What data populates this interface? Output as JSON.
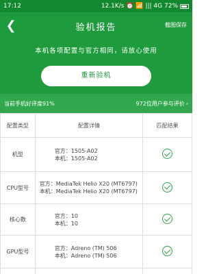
{
  "status_bar": {
    "time": "17:12",
    "indicators": "12.1K/s ⏰ 📶 ||| 4G 72%",
    "battery_level": 0.72
  },
  "header": {
    "title": "验机报告",
    "action": "截图保存"
  },
  "summary": {
    "tagline": "本机各项配置与官方相同，请放心使用",
    "retest_label": "重新验机"
  },
  "score_bar": {
    "left": "当前手机好评度91%",
    "right": "972位用户参与评价"
  },
  "table": {
    "headers": [
      "配置类型",
      "配置详情",
      "匹配结果"
    ],
    "rows": [
      {
        "type": "机型",
        "official": "官方：1505-A02",
        "device": "本机：1505-A02"
      },
      {
        "type": "CPU型号",
        "official": "官方：MediaTek Helio X20 (MT6797)",
        "device": "本机：MediaTek Helio X20 (MT6797)"
      },
      {
        "type": "核心数",
        "official": "官方：10",
        "device": "本机：10"
      },
      {
        "type": "GPU型号",
        "official": "官方：Adreno (TM) 506",
        "device": "本机：Adreno (TM) 506"
      }
    ]
  },
  "colors": {
    "brand_green": "#1e9b3c",
    "status_green": "#12882f",
    "score_green": "#31a84d",
    "check_green": "#2aa44a"
  },
  "icons": {
    "back": "back-arrow-icon",
    "match": "check-circle-icon"
  }
}
